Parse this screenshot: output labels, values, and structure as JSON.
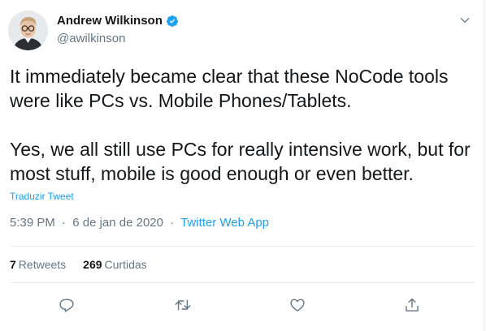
{
  "tweet": {
    "author": {
      "display_name": "Andrew Wilkinson",
      "handle": "@awilkinson",
      "verified": true
    },
    "paragraphs": [
      "It immediately became clear that these NoCode tools were like PCs vs. Mobile Phones/Tablets.",
      "Yes, we all still use PCs for really intensive work, but for most stuff, mobile is good enough or even better."
    ],
    "translate_label": "Traduzir Tweet",
    "time": "5:39 PM",
    "date": "6 de jan de 2020",
    "separator": "·",
    "source": "Twitter Web App",
    "stats": {
      "retweets_count": "7",
      "retweets_label": "Retweets",
      "likes_count": "269",
      "likes_label": "Curtidas"
    },
    "actions": [
      "reply-icon",
      "retweet-icon",
      "like-icon",
      "share-icon"
    ]
  },
  "colors": {
    "accent": "#1da1f2",
    "text": "#14171a",
    "secondary": "#657786",
    "border": "#e6ecf0"
  }
}
